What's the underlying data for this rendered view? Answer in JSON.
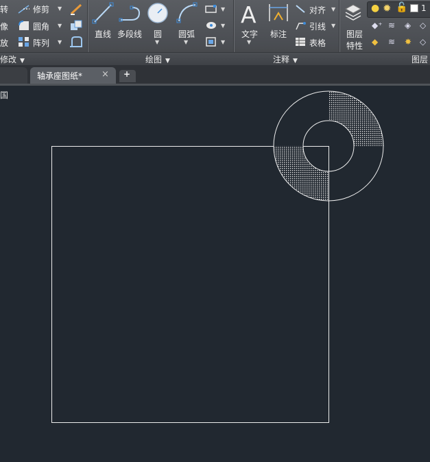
{
  "modify": {
    "rotate": "转",
    "mirror": "像",
    "scale": "放",
    "trim": "修剪",
    "fillet": "圆角",
    "array": "阵列",
    "panel": "修改"
  },
  "draw": {
    "line": "直线",
    "polyline": "多段线",
    "circle": "圆",
    "arc": "圆弧",
    "panel": "绘图"
  },
  "annotation": {
    "text": "文字",
    "dimension": "标注",
    "align": "对齐",
    "leader": "引线",
    "table": "表格",
    "panel": "注释"
  },
  "layers": {
    "properties_line1": "图层",
    "properties_line2": "特性",
    "panel": "图层",
    "layer_value": "1"
  },
  "tabs": {
    "active": "轴承座图纸*",
    "close": "×",
    "add": "+"
  },
  "canvas": {
    "viewport_label": "国"
  },
  "colors": {
    "ribbon": "#4f5257",
    "canvas": "#212830",
    "accent": "#3d8bd9"
  }
}
